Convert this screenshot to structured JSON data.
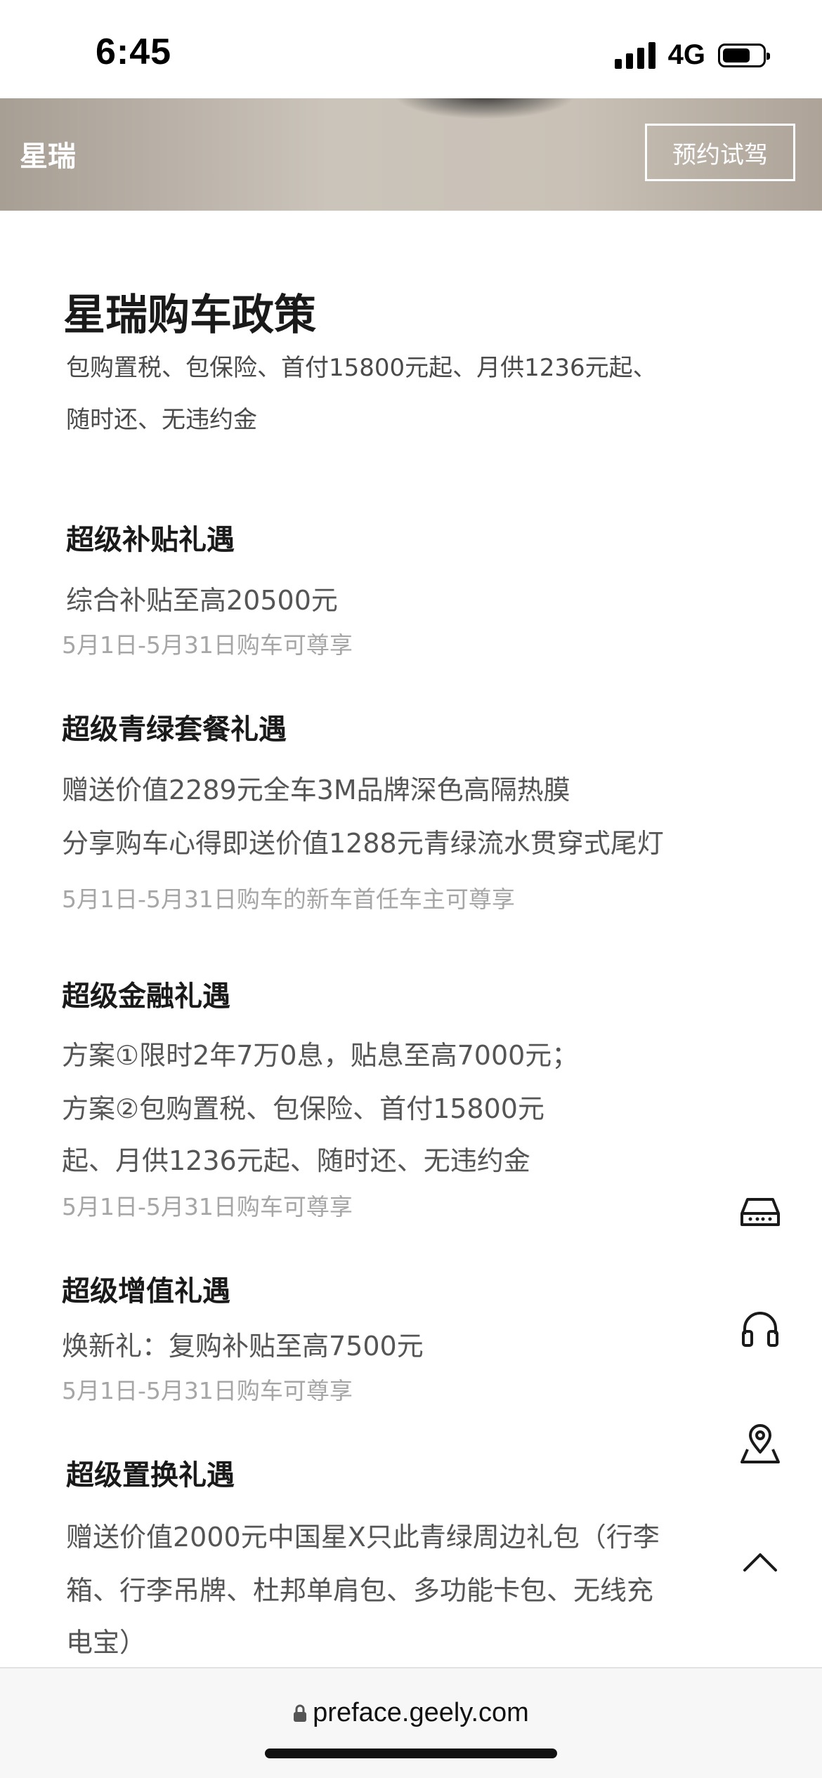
{
  "status_bar": {
    "time": "6:45",
    "network": "4G",
    "battery_level": 0.7
  },
  "header": {
    "brand": "星瑞",
    "test_drive_button": "预约试驾"
  },
  "page": {
    "title": "星瑞购车政策",
    "policy_lines": [
      "包购置税、包保险、首付15800元起、月供1236元起、",
      "随时还、无违约金"
    ]
  },
  "sections": [
    {
      "title": "超级补贴礼遇",
      "lines": [
        "综合补贴至高20500元"
      ],
      "note": "5月1日-5月31日购车可尊享"
    },
    {
      "title": "超级青绿套餐礼遇",
      "lines": [
        "赠送价值2289元全车3M品牌深色高隔热膜",
        "分享购车心得即送价值1288元青绿流水贯穿式尾灯"
      ],
      "note": "5月1日-5月31日购车的新车首任车主可尊享"
    },
    {
      "title": "超级金融礼遇",
      "lines": [
        "方案①限时2年7万0息，贴息至高7000元；",
        "方案②包购置税、包保险、首付15800元",
        "起、月供1236元起、随时还、无违约金"
      ],
      "note": "5月1日-5月31日购车可尊享"
    },
    {
      "title": "超级增值礼遇",
      "lines": [
        "焕新礼：复购补贴至高7500元"
      ],
      "note": "5月1日-5月31日购车可尊享"
    },
    {
      "title": "超级置换礼遇",
      "lines": [
        "赠送价值2000元中国星X只此青绿周边礼包（行李",
        "箱、行李吊牌、杜邦单肩包、多功能卡包、无线充",
        "电宝）"
      ]
    }
  ],
  "float_actions": [
    "car-icon",
    "headset-icon",
    "location-pin-icon",
    "chevron-up-icon"
  ],
  "url_bar": {
    "url": "preface.geely.com"
  }
}
